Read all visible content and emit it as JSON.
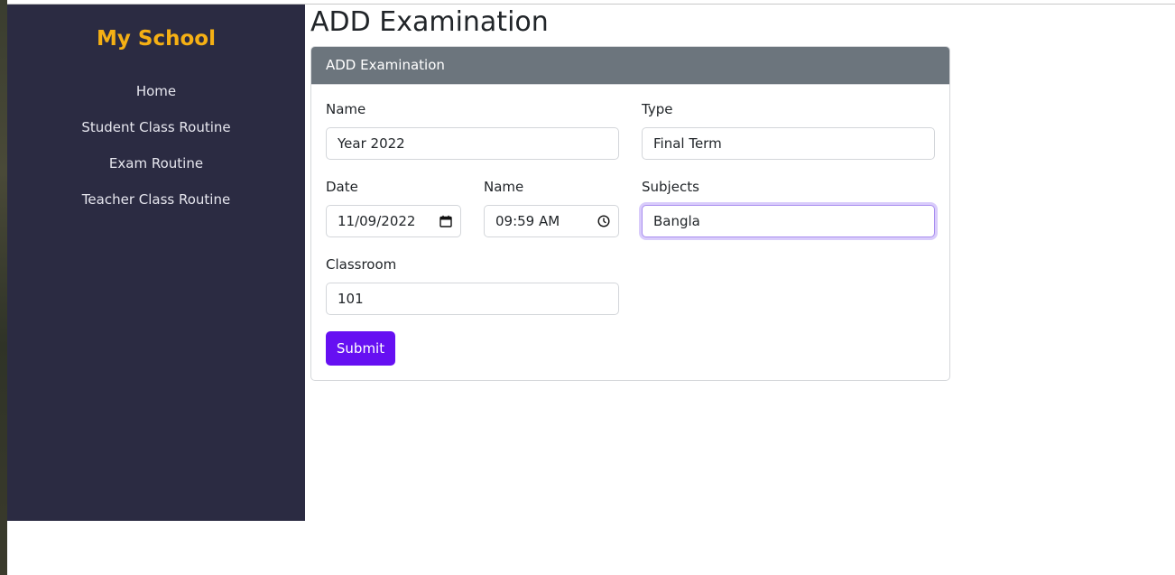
{
  "sidebar": {
    "brand": "My School",
    "brand_color": "#f5b014",
    "background": "#2b2b42",
    "items": [
      {
        "label": "Home"
      },
      {
        "label": "Student Class Routine"
      },
      {
        "label": "Exam Routine"
      },
      {
        "label": "Teacher Class Routine"
      }
    ]
  },
  "page": {
    "title": "ADD Examination"
  },
  "form": {
    "header": "ADD Examination",
    "header_color": "#6c757d",
    "fields": {
      "name": {
        "label": "Name",
        "value": "Year 2022"
      },
      "type": {
        "label": "Type",
        "value": "Final Term"
      },
      "date": {
        "label": "Date",
        "value": "11/09/2022",
        "icon": "calendar-icon"
      },
      "time": {
        "label": "Name",
        "value": "09:59 AM",
        "icon": "clock-icon"
      },
      "subjects": {
        "label": "Subjects",
        "value": "Bangla",
        "focused": true
      },
      "classroom": {
        "label": "Classroom",
        "value": "101"
      }
    },
    "submit_label": "Submit",
    "submit_color": "#6610f2"
  }
}
